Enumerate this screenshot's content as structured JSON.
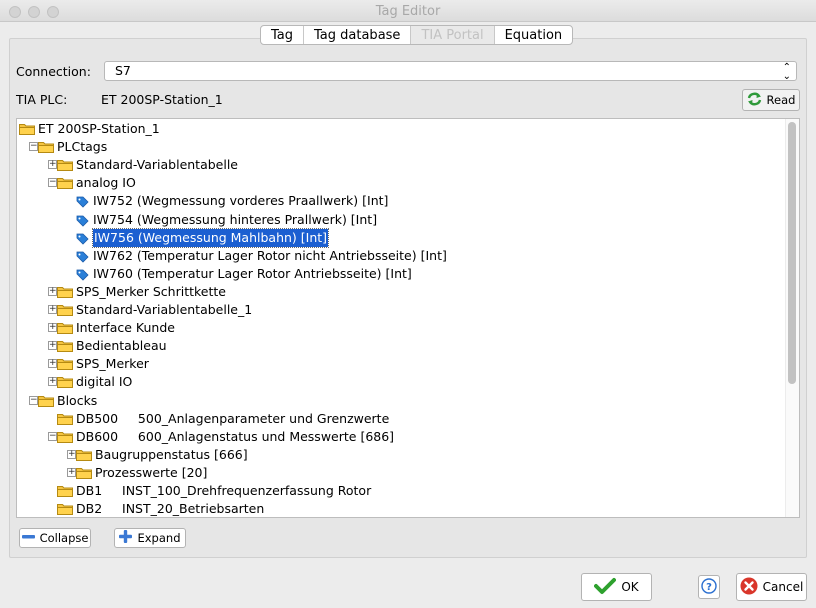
{
  "window": {
    "title": "Tag Editor"
  },
  "tabs": [
    {
      "label": "Tag",
      "enabled": true
    },
    {
      "label": "Tag database",
      "enabled": true
    },
    {
      "label": "TIA Portal",
      "enabled": false
    },
    {
      "label": "Equation",
      "enabled": true
    }
  ],
  "connection": {
    "label": "Connection:",
    "value": "S7"
  },
  "tia_plc": {
    "label": "TIA PLC:",
    "value": "ET 200SP-Station_1"
  },
  "read_button": {
    "label": "Read",
    "icon": "refresh-icon",
    "icon_color": "#2f9a3a"
  },
  "tree": {
    "selected_color": "#1b5fd1",
    "rows": [
      {
        "level": 0,
        "type": "folder",
        "expander": "",
        "text": "ET 200SP-Station_1"
      },
      {
        "level": 1,
        "type": "folder",
        "expander": "−",
        "text": "PLCtags"
      },
      {
        "level": 2,
        "type": "folder",
        "expander": "+",
        "text": "Standard-Variablentabelle"
      },
      {
        "level": 2,
        "type": "folder",
        "expander": "−",
        "text": "analog IO"
      },
      {
        "level": 3,
        "type": "tag",
        "expander": "",
        "text": "IW752 (Wegmessung vorderes Praallwerk) [Int]"
      },
      {
        "level": 3,
        "type": "tag",
        "expander": "",
        "text": "IW754 (Wegmessung hinteres Prallwerk) [Int]"
      },
      {
        "level": 3,
        "type": "tag",
        "expander": "",
        "text": "IW756 (Wegmessung Mahlbahn) [Int]",
        "selected": true
      },
      {
        "level": 3,
        "type": "tag",
        "expander": "",
        "text": "IW762 (Temperatur Lager Rotor nicht Antriebsseite) [Int]"
      },
      {
        "level": 3,
        "type": "tag",
        "expander": "",
        "text": "IW760 (Temperatur Lager Rotor Antriebsseite) [Int]"
      },
      {
        "level": 2,
        "type": "folder",
        "expander": "+",
        "text": "SPS_Merker Schrittkette"
      },
      {
        "level": 2,
        "type": "folder",
        "expander": "+",
        "text": "Standard-Variablentabelle_1"
      },
      {
        "level": 2,
        "type": "folder",
        "expander": "+",
        "text": "Interface Kunde"
      },
      {
        "level": 2,
        "type": "folder",
        "expander": "+",
        "text": "Bedientableau"
      },
      {
        "level": 2,
        "type": "folder",
        "expander": "+",
        "text": "SPS_Merker"
      },
      {
        "level": 2,
        "type": "folder",
        "expander": "+",
        "text": "digital IO"
      },
      {
        "level": 1,
        "type": "folder",
        "expander": "−",
        "text": "Blocks"
      },
      {
        "level": 2,
        "type": "folder",
        "expander": "",
        "text": "DB500     500_Anlagenparameter und Grenzwerte"
      },
      {
        "level": 2,
        "type": "folder",
        "expander": "−",
        "text": "DB600     600_Anlagenstatus und Messwerte [686]"
      },
      {
        "level": 3,
        "type": "folder",
        "expander": "+",
        "text": "Baugruppenstatus [666]"
      },
      {
        "level": 3,
        "type": "folder",
        "expander": "+",
        "text": "Prozesswerte [20]"
      },
      {
        "level": 2,
        "type": "folder",
        "expander": "",
        "text": "DB1     INST_100_Drehfrequenzerfassung Rotor"
      },
      {
        "level": 2,
        "type": "folder",
        "expander": "",
        "text": "DB2     INST_20_Betriebsarten"
      }
    ]
  },
  "collapse_button": {
    "label": "Collapse",
    "icon": "minus-icon"
  },
  "expand_button": {
    "label": "Expand",
    "icon": "plus-icon"
  },
  "ok_button": {
    "label": "OK",
    "icon": "checkmark-icon",
    "icon_color": "#2ea12e"
  },
  "help_button": {
    "label": "?",
    "icon": "help-icon",
    "icon_color": "#2a6fd0"
  },
  "cancel_button": {
    "label": "Cancel",
    "icon": "cancel-icon",
    "icon_color": "#d9362b"
  }
}
